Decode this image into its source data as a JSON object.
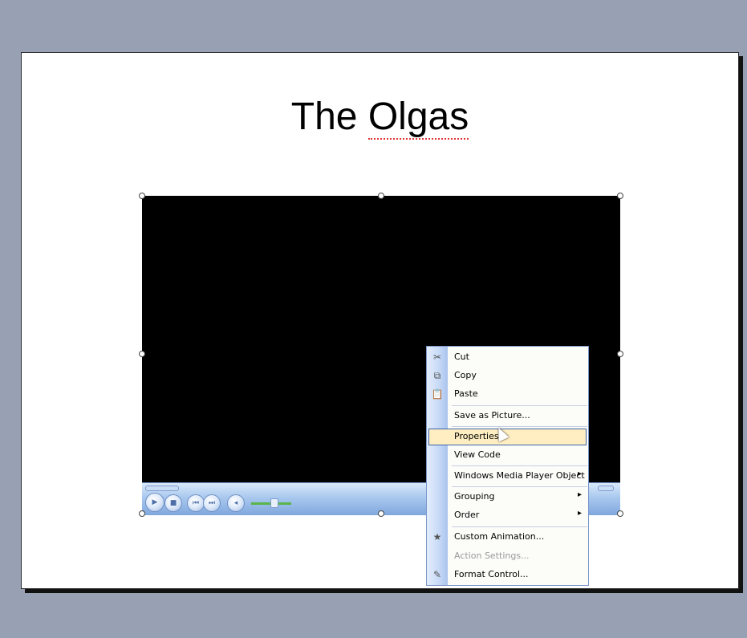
{
  "slide": {
    "title_pre": "The ",
    "title_misspelled": "Olgas"
  },
  "player": {
    "buttons": [
      {
        "name": "play-button-icon",
        "glyph": "▶"
      },
      {
        "name": "stop-button-icon",
        "glyph": "■"
      },
      {
        "name": "previous-button-icon",
        "glyph": "⏮"
      },
      {
        "name": "next-button-icon",
        "glyph": "⏭"
      },
      {
        "name": "mute-button-icon",
        "glyph": "◂"
      }
    ]
  },
  "context_menu": {
    "items": [
      {
        "label": "Cut",
        "icon": "scissors-icon",
        "glyph": "✂"
      },
      {
        "label": "Copy",
        "icon": "copy-icon",
        "glyph": "⧉"
      },
      {
        "label": "Paste",
        "icon": "paste-icon",
        "glyph": "📋"
      },
      {
        "label": "Save as Picture..."
      },
      {
        "label": "Properties"
      },
      {
        "label": "View Code"
      },
      {
        "label": "Windows Media Player Object",
        "submenu": "▸"
      },
      {
        "label": "Grouping",
        "submenu": "▸"
      },
      {
        "label": "Order",
        "submenu": "▸"
      },
      {
        "label": "Custom Animation...",
        "icon": "custom-animation-icon",
        "glyph": "★"
      },
      {
        "label": "Action Settings...",
        "disabled": true
      },
      {
        "label": "Format Control...",
        "icon": "format-control-icon",
        "glyph": "✎"
      }
    ]
  },
  "colors": {
    "background": "#98a0b3",
    "slide": "#ffffff",
    "menu_highlight": "#ffeec2",
    "menu_highlight_border": "#3d63a8"
  }
}
